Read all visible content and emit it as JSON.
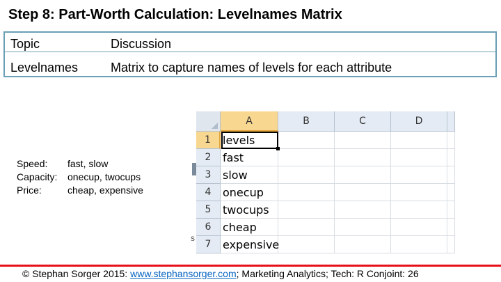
{
  "title": "Step 8: Part-Worth Calculation: Levelnames Matrix",
  "table": {
    "rows": [
      [
        "Topic",
        "Discussion"
      ],
      [
        "Levelnames",
        "Matrix to capture names of levels for each attribute"
      ]
    ]
  },
  "levels": [
    {
      "label": "Speed:",
      "value": "fast, slow"
    },
    {
      "label": "Capacity:",
      "value": "onecup, twocups"
    },
    {
      "label": "Price:",
      "value": "cheap, expensive"
    }
  ],
  "spreadsheet": {
    "columns": [
      "A",
      "B",
      "C",
      "D"
    ],
    "rows": [
      "1",
      "2",
      "3",
      "4",
      "5",
      "6",
      "7"
    ],
    "cells": [
      "levels",
      "fast",
      "slow",
      "onecup",
      "twocups",
      "cheap",
      "expensive"
    ],
    "active_cell": "A1"
  },
  "margin_mark": "s",
  "footer": {
    "prefix": "© Stephan Sorger 2015: ",
    "link": "www.stephansorger.com",
    "suffix": "; Marketing Analytics; Tech: R Conjoint: 26"
  },
  "colors": {
    "accent_line": "#e8101a",
    "table_border": "#6a9fb5",
    "link": "#0563c1",
    "selection": "#f8d790"
  }
}
